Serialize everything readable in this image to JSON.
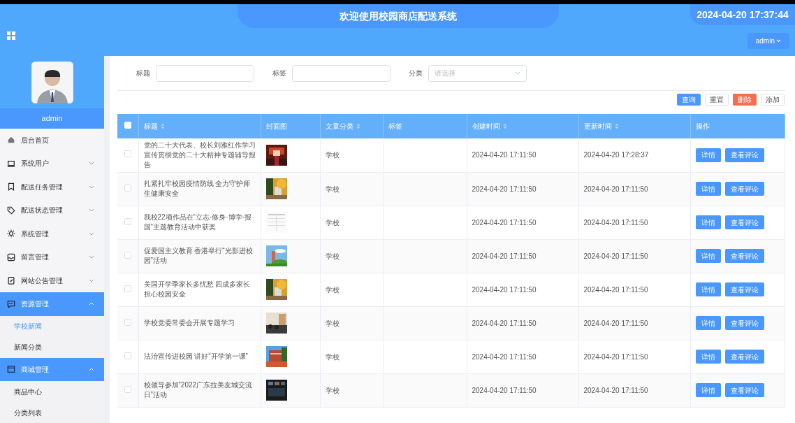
{
  "header": {
    "title": "欢迎使用校园商店配送系统",
    "datetime": "2024-04-20 17:37:44",
    "user_menu": "admin"
  },
  "sidebar": {
    "user": "admin",
    "items": [
      {
        "kind": "link",
        "label": "后台首页"
      },
      {
        "kind": "group",
        "label": "系统用户",
        "expanded": false
      },
      {
        "kind": "group",
        "label": "配送任务管理",
        "expanded": false
      },
      {
        "kind": "group",
        "label": "配送状态管理",
        "expanded": false
      },
      {
        "kind": "group",
        "label": "系统管理",
        "expanded": false
      },
      {
        "kind": "group",
        "label": "留言管理",
        "expanded": false
      },
      {
        "kind": "group",
        "label": "网站公告管理",
        "expanded": false
      },
      {
        "kind": "group",
        "label": "资源管理",
        "expanded": true,
        "children": [
          {
            "label": "学校新闻",
            "selected": true
          },
          {
            "label": "新闻分类",
            "selected": false
          }
        ]
      },
      {
        "kind": "group",
        "label": "商城管理",
        "expanded": true,
        "children": [
          {
            "label": "商品中心",
            "selected": false
          },
          {
            "label": "分类列表",
            "selected": false
          }
        ]
      }
    ]
  },
  "filters": [
    {
      "kind": "text",
      "label": "标题"
    },
    {
      "kind": "text",
      "label": "标签"
    },
    {
      "kind": "select",
      "label": "分类",
      "placeholder": "请选择"
    }
  ],
  "buttons": [
    {
      "kind": "primary",
      "label": "查询"
    },
    {
      "kind": "plain",
      "label": "重置"
    },
    {
      "kind": "danger",
      "label": "删除"
    },
    {
      "kind": "plain",
      "label": "添加"
    }
  ],
  "table": {
    "select_all": false,
    "columns": [
      {
        "label": "标题",
        "sortable": true
      },
      {
        "label": "封面图",
        "sortable": false
      },
      {
        "label": "文章分类",
        "sortable": true
      },
      {
        "label": "标签",
        "sortable": false
      },
      {
        "label": "创建时间",
        "sortable": true
      },
      {
        "label": "更新时间",
        "sortable": true
      },
      {
        "label": "操作",
        "sortable": false
      }
    ],
    "rows": [
      {
        "checked": false,
        "title": "党的二十大代表、校长刘雅红作学习宣传贯彻党的二十大精神专题辅导报告",
        "cover": {
          "kind": "picture"
        },
        "category": "学校",
        "created": "2024-04-20 17:11:50",
        "updated": "2024-04-20 17:28:37",
        "actions": [
          "详情",
          "查看评论"
        ]
      },
      {
        "checked": false,
        "title": "扎紧扎牢校园疫情防线 全力守护师生健康安全",
        "cover": {
          "kind": "picture"
        },
        "category": "学校",
        "created": "2024-04-20 17:11:50",
        "updated": "2024-04-20 17:11:50",
        "actions": [
          "详情",
          "查看评论"
        ]
      },
      {
        "checked": false,
        "title": "我校22项作品在“立志·修身·博学·报国”主题教育活动中获奖",
        "cover": {
          "kind": "picture"
        },
        "category": "学校",
        "created": "2024-04-20 17:11:50",
        "updated": "2024-04-20 17:11:50",
        "actions": [
          "详情",
          "查看评论"
        ]
      },
      {
        "checked": false,
        "title": "促爱国主义教育 香港举行“光影进校园”活动",
        "cover": {
          "kind": "picture"
        },
        "category": "学校",
        "created": "2024-04-20 17:11:50",
        "updated": "2024-04-20 17:11:50",
        "actions": [
          "详情",
          "查看评论"
        ]
      },
      {
        "checked": false,
        "title": "美国开学季家长多忧愁 四成多家长担心校园安全",
        "cover": {
          "kind": "picture"
        },
        "category": "学校",
        "created": "2024-04-20 17:11:50",
        "updated": "2024-04-20 17:11:50",
        "actions": [
          "详情",
          "查看评论"
        ]
      },
      {
        "checked": false,
        "title": "学校党委常委会开展专题学习",
        "cover": {
          "kind": "picture"
        },
        "category": "学校",
        "created": "2024-04-20 17:11:50",
        "updated": "2024-04-20 17:11:50",
        "actions": [
          "详情",
          "查看评论"
        ]
      },
      {
        "checked": false,
        "title": "法治宣传进校园 讲好“开学第一课”",
        "cover": {
          "kind": "picture"
        },
        "category": "学校",
        "created": "2024-04-20 17:11:50",
        "updated": "2024-04-20 17:11:50",
        "actions": [
          "详情",
          "查看评论"
        ]
      },
      {
        "checked": false,
        "title": "校领导参加“2022广东拉美友城交流日”活动",
        "cover": {
          "kind": "picture"
        },
        "category": "学校",
        "created": "2024-04-20 17:11:50",
        "updated": "2024-04-20 17:11:50",
        "actions": [
          "详情",
          "查看评论"
        ]
      }
    ]
  }
}
